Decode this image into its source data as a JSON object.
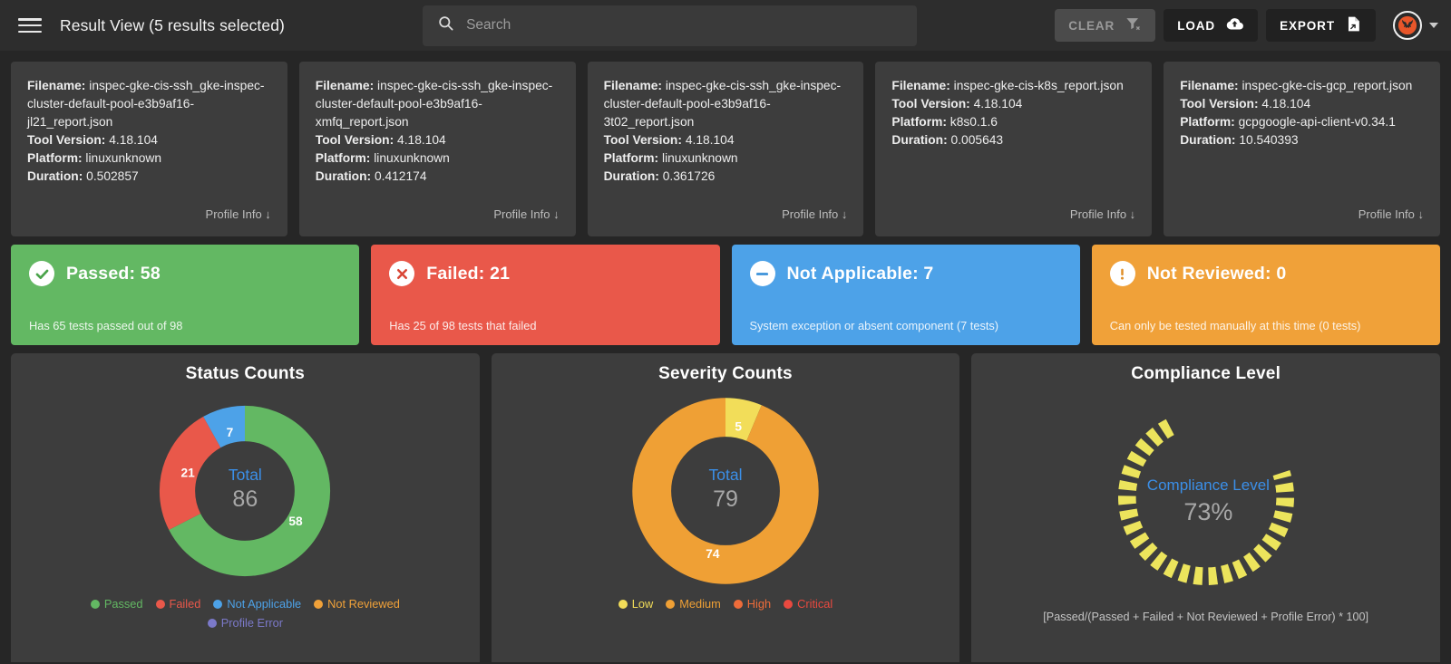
{
  "header": {
    "menu_icon": "hamburger-menu-icon",
    "title": "Result View (5 results selected)",
    "search": {
      "icon": "search-icon",
      "value": "",
      "placeholder": "Search"
    },
    "clear_label": "CLEAR",
    "clear_icon": "filter-remove-icon",
    "load_label": "LOAD",
    "load_icon": "cloud-upload-icon",
    "export_label": "EXPORT",
    "export_icon": "file-export-icon",
    "avatar_icon": "heimdall-logo-icon",
    "avatar_caret_icon": "chevron-down-icon",
    "accent_color": "#e8562a"
  },
  "file_cards": [
    {
      "filename_label": "Filename:",
      "filename": "inspec-gke-cis-ssh_gke-inspec-cluster-default-pool-e3b9af16-jl21_report.json",
      "tool_version_label": "Tool Version:",
      "tool_version": "4.18.104",
      "platform_label": "Platform:",
      "platform": "linuxunknown",
      "duration_label": "Duration:",
      "duration": "0.502857",
      "profile_info_label": "Profile Info ↓"
    },
    {
      "filename_label": "Filename:",
      "filename": "inspec-gke-cis-ssh_gke-inspec-cluster-default-pool-e3b9af16-xmfq_report.json",
      "tool_version_label": "Tool Version:",
      "tool_version": "4.18.104",
      "platform_label": "Platform:",
      "platform": "linuxunknown",
      "duration_label": "Duration:",
      "duration": "0.412174",
      "profile_info_label": "Profile Info ↓"
    },
    {
      "filename_label": "Filename:",
      "filename": "inspec-gke-cis-ssh_gke-inspec-cluster-default-pool-e3b9af16-3t02_report.json",
      "tool_version_label": "Tool Version:",
      "tool_version": "4.18.104",
      "platform_label": "Platform:",
      "platform": "linuxunknown",
      "duration_label": "Duration:",
      "duration": "0.361726",
      "profile_info_label": "Profile Info ↓"
    },
    {
      "filename_label": "Filename:",
      "filename": "inspec-gke-cis-k8s_report.json",
      "tool_version_label": "Tool Version:",
      "tool_version": "4.18.104",
      "platform_label": "Platform:",
      "platform": "k8s0.1.6",
      "duration_label": "Duration:",
      "duration": "0.005643",
      "profile_info_label": "Profile Info ↓"
    },
    {
      "filename_label": "Filename:",
      "filename": "inspec-gke-cis-gcp_report.json",
      "tool_version_label": "Tool Version:",
      "tool_version": "4.18.104",
      "platform_label": "Platform:",
      "platform": "gcpgoogle-api-client-v0.34.1",
      "duration_label": "Duration:",
      "duration": "10.540393",
      "profile_info_label": "Profile Info ↓"
    }
  ],
  "status_banners": [
    {
      "name": "passed",
      "title": "Passed: 58",
      "subtitle": "Has 65 tests passed out of 98",
      "color": "#63b863",
      "icon": "check-circle-icon"
    },
    {
      "name": "failed",
      "title": "Failed: 21",
      "subtitle": "Has 25 of 98 tests that failed",
      "color": "#e9584a",
      "icon": "x-circle-icon"
    },
    {
      "name": "not-applicable",
      "title": "Not Applicable: 7",
      "subtitle": "System exception or absent component (7 tests)",
      "color": "#4da2e8",
      "icon": "minus-circle-icon"
    },
    {
      "name": "not-reviewed",
      "title": "Not Reviewed: 0",
      "subtitle": "Can only be tested manually at this time (0 tests)",
      "color": "#f0a139",
      "icon": "exclamation-circle-icon"
    }
  ],
  "chart_data": [
    {
      "type": "pie",
      "name": "status-counts",
      "title": "Status Counts",
      "center_label": "Total",
      "center_value": "86",
      "total": 86,
      "categories": [
        "Passed",
        "Failed",
        "Not Applicable",
        "Not Reviewed",
        "Profile Error"
      ],
      "values": [
        58,
        21,
        7,
        0,
        0
      ],
      "colors": [
        "#63b863",
        "#e9584a",
        "#4da2e8",
        "#f0a139",
        "#7b79c9"
      ],
      "slice_labels": [
        "58",
        "21",
        "7"
      ],
      "legend_position": "bottom"
    },
    {
      "type": "pie",
      "name": "severity-counts",
      "title": "Severity Counts",
      "center_label": "Total",
      "center_value": "79",
      "total": 79,
      "categories": [
        "Low",
        "Medium",
        "High",
        "Critical"
      ],
      "values": [
        5,
        74,
        0,
        0
      ],
      "colors": [
        "#f2dd59",
        "#efa035",
        "#ee6c3a",
        "#e9493f"
      ],
      "slice_labels": [
        "5",
        "74"
      ],
      "legend_position": "bottom"
    },
    {
      "type": "pie",
      "name": "compliance-level",
      "title": "Compliance Level",
      "center_label": "Compliance Level",
      "center_value": "73%",
      "percent": 73,
      "color": "#ece45c",
      "footnote": "[Passed/(Passed + Failed + Not Reviewed + Profile Error) * 100]"
    }
  ]
}
